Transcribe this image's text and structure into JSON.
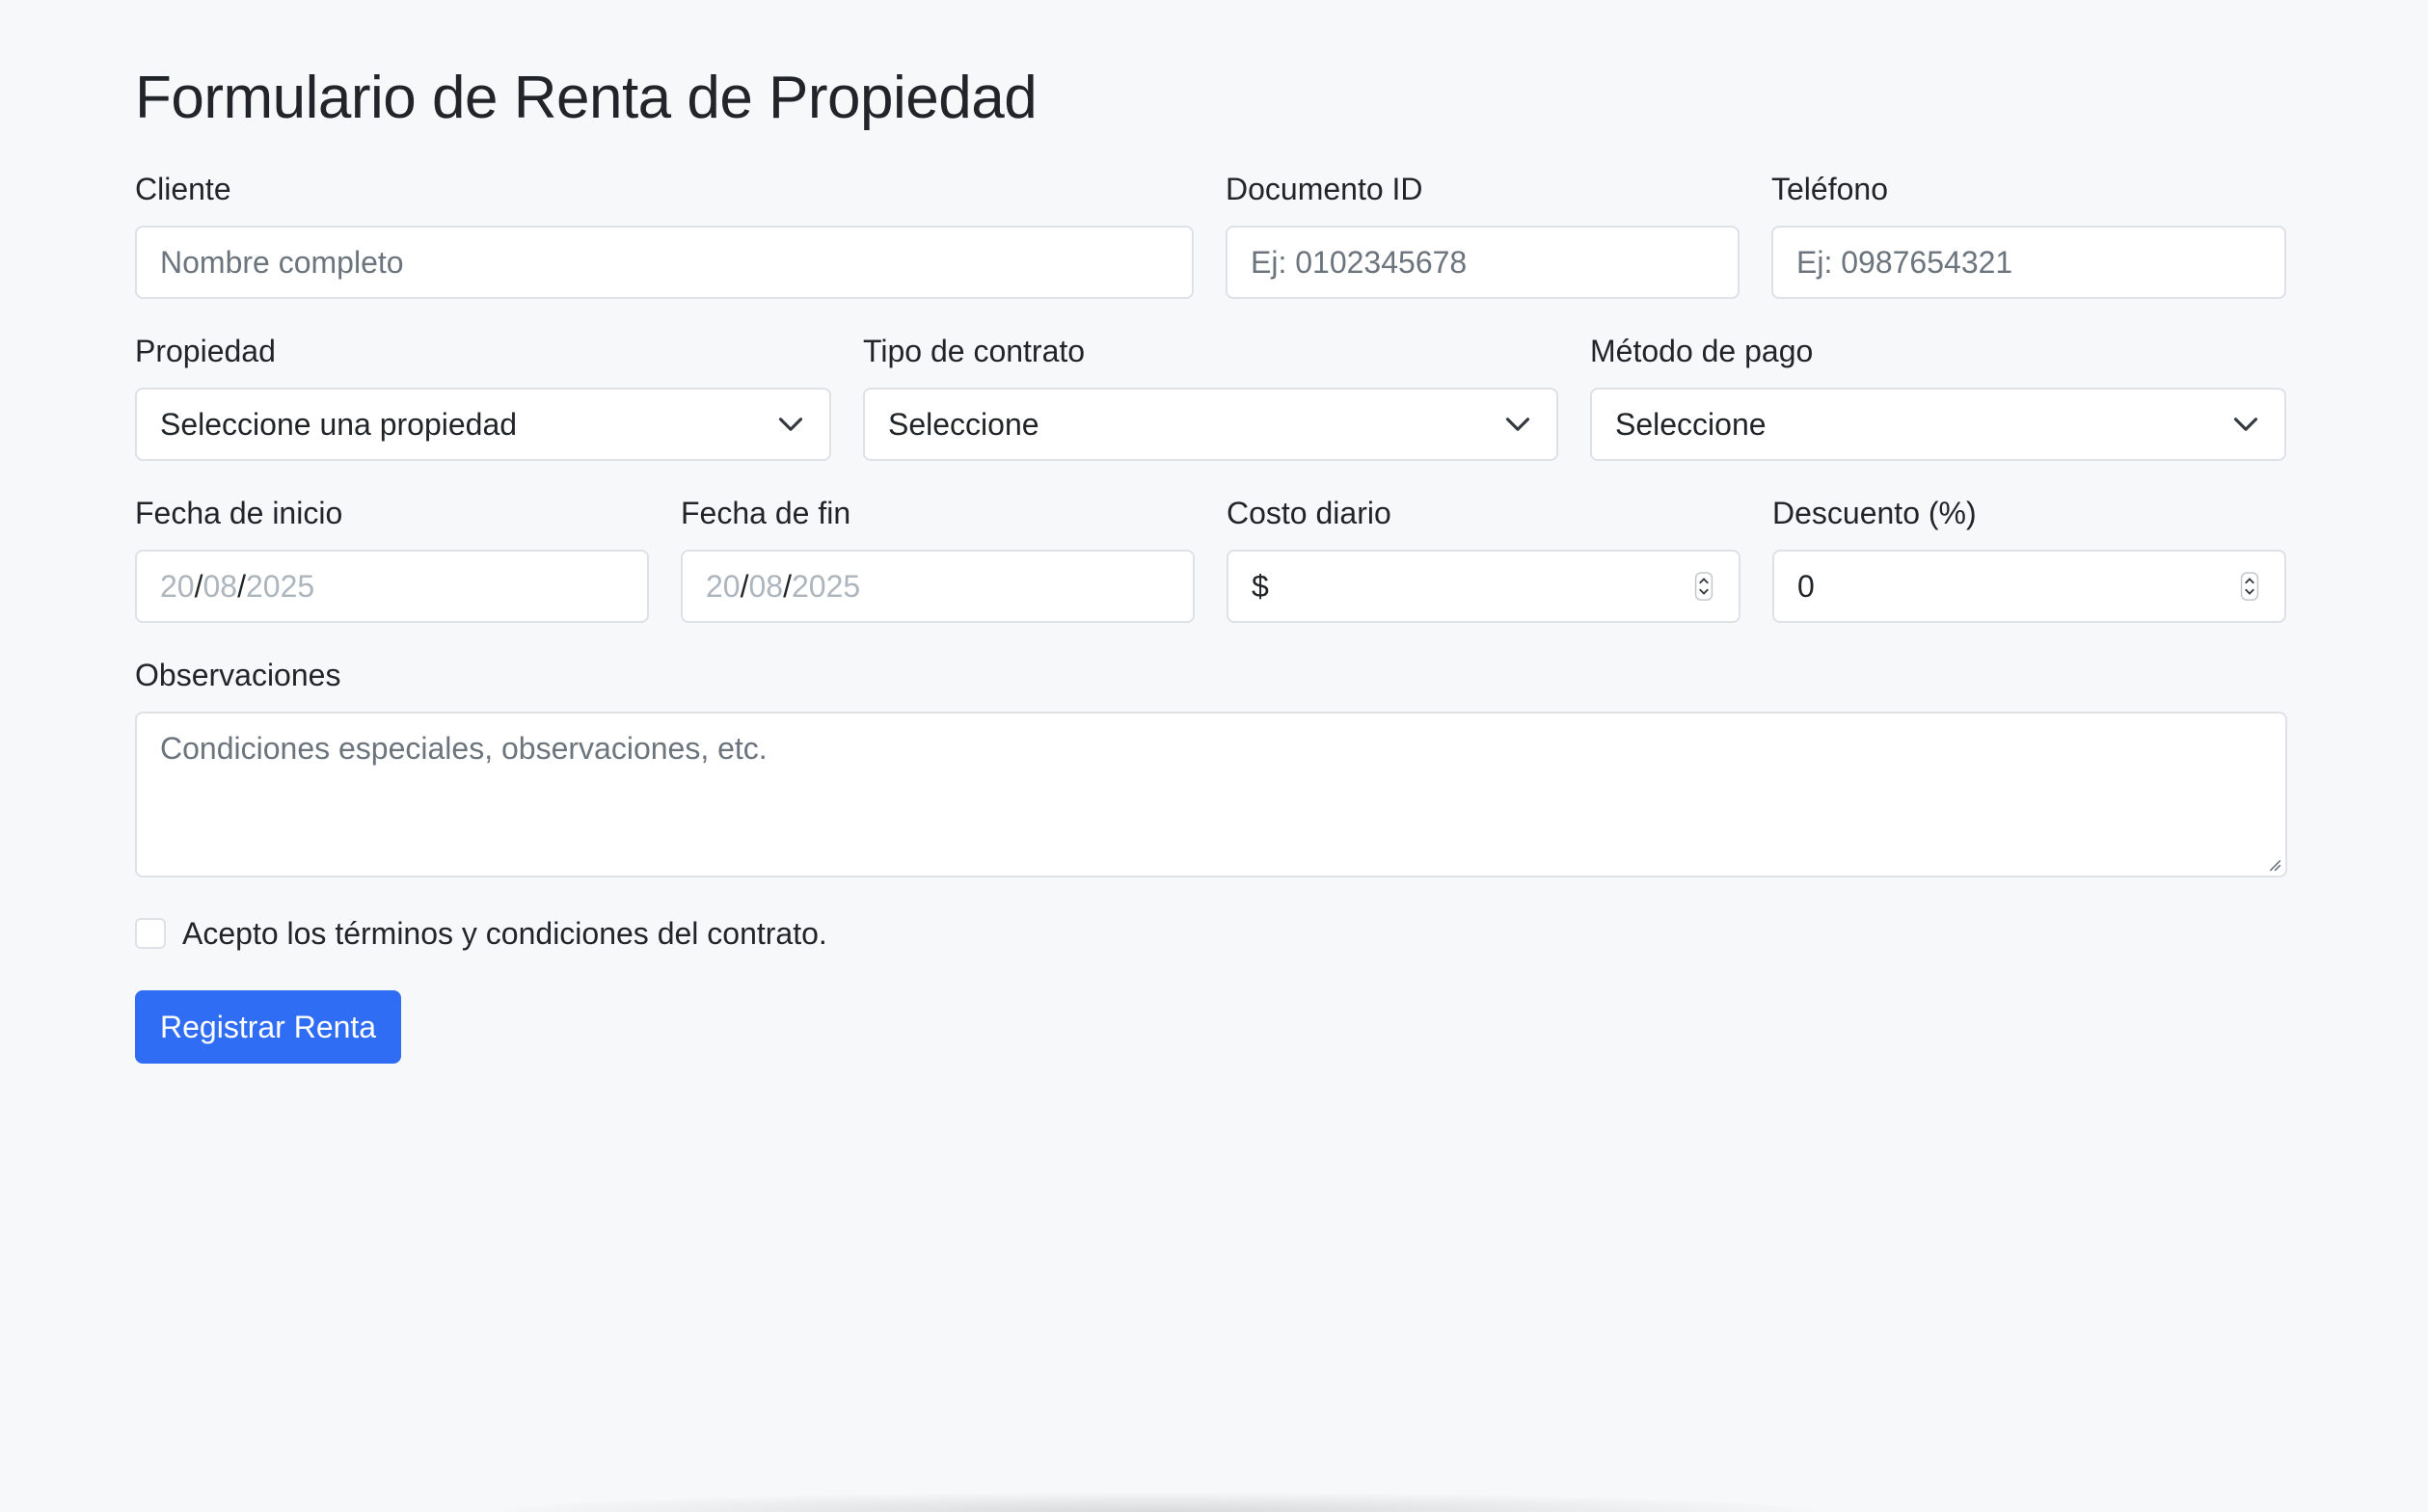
{
  "title": "Formulario de Renta de Propiedad",
  "cliente": {
    "label": "Cliente",
    "placeholder": "Nombre completo"
  },
  "documento": {
    "label": "Documento ID",
    "placeholder": "Ej: 0102345678"
  },
  "telefono": {
    "label": "Teléfono",
    "placeholder": "Ej: 0987654321"
  },
  "propiedad": {
    "label": "Propiedad",
    "selected": "Seleccione una propiedad"
  },
  "tipo_contrato": {
    "label": "Tipo de contrato",
    "selected": "Seleccione"
  },
  "metodo_pago": {
    "label": "Método de pago",
    "selected": "Seleccione"
  },
  "fecha_inicio": {
    "label": "Fecha de inicio",
    "day": "20",
    "month": "08",
    "year": "2025",
    "sep": "/"
  },
  "fecha_fin": {
    "label": "Fecha de fin",
    "day": "20",
    "month": "08",
    "year": "2025",
    "sep": "/"
  },
  "costo_diario": {
    "label": "Costo diario",
    "prefix": "$"
  },
  "descuento": {
    "label": "Descuento (%)",
    "value": "0"
  },
  "observaciones": {
    "label": "Observaciones",
    "placeholder": "Condiciones especiales, observaciones, etc."
  },
  "terminos": {
    "label": "Acepto los términos y condiciones del contrato.",
    "checked": false
  },
  "submit": {
    "label": "Registrar Renta"
  },
  "colors": {
    "background": "#f7f8fa",
    "primary": "#2f6df4",
    "border": "#dee2e6",
    "placeholder": "#6c757d"
  },
  "icons": {
    "select": "chevron-down-icon",
    "number": "spinner-icon",
    "textarea": "resize-handle-icon"
  }
}
